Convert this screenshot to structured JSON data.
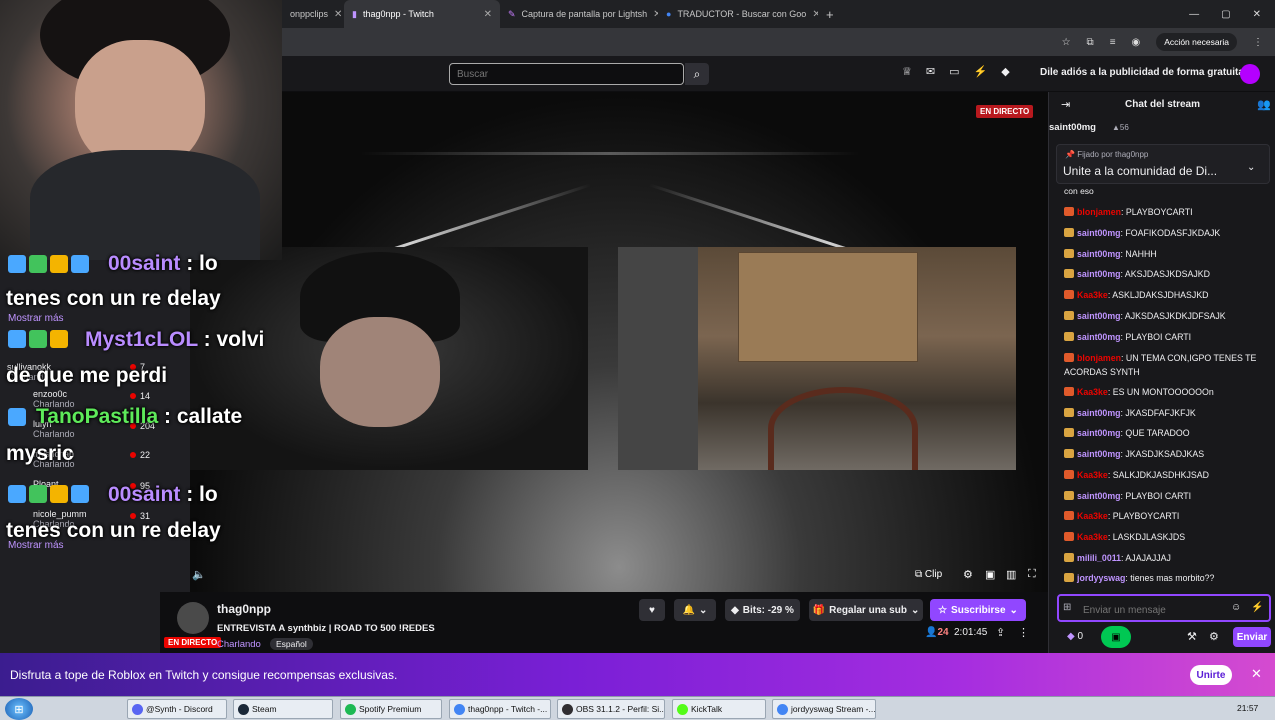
{
  "browser": {
    "tabs": [
      {
        "label": "onppclips"
      },
      {
        "label": "thag0npp - Twitch",
        "active": true
      },
      {
        "label": "Captura de pantalla por Lightsh"
      },
      {
        "label": "TRADUCTOR - Buscar con Goo"
      }
    ],
    "action_needed": "Acción necesaria"
  },
  "twitch_nav": {
    "search_placeholder": "Buscar",
    "ad_free": "Dile adiós a la publicidad de forma gratuita"
  },
  "player": {
    "live_badge": "EN DIRECTO",
    "clip": "Clip"
  },
  "left_overlay": {
    "more": "Mostrar más",
    "recs": [
      {
        "name": "sullivanokk",
        "status": "Charlando",
        "viewers": "7"
      },
      {
        "name": "enzoo0c",
        "status": "Charlando",
        "viewers": "14"
      },
      {
        "name": "lulyn",
        "status": "Charlando",
        "viewers": "204"
      },
      {
        "name": "mysrichah",
        "status": "Charlando",
        "viewers": "22"
      },
      {
        "name": "Ploant",
        "status": "",
        "viewers": "95"
      },
      {
        "name": "nicole_pumm",
        "status": "Charlando",
        "viewers": "31"
      }
    ],
    "big_messages": [
      {
        "name": "00saint",
        "text": " : lo",
        "line2": "tenes con un re delay"
      },
      {
        "name": "Myst1cLOL",
        "text": " : volvi",
        "line2": "de que me perdi"
      },
      {
        "name": "TanoPastilla",
        "text": " : callate",
        "line2": "mysric"
      },
      {
        "name": "00saint",
        "text": " : lo",
        "line2": "tenes con un re delay"
      }
    ]
  },
  "stream_info": {
    "channel": "thag0npp",
    "title": "ENTREVISTA A synthbiz | ROAD TO 500 !REDES",
    "category": "Charlando",
    "language": "Español",
    "live_badge": "EN DIRECTO",
    "bits": "Bits: -29 %",
    "gift_sub": "Regalar una sub",
    "subscribe": "Suscribirse",
    "viewers": "24",
    "uptime": "2:01:45"
  },
  "chat": {
    "header": "Chat del stream",
    "top_gifter": "saint00mg",
    "top_gifter_count": "56",
    "pinned_by": "Fijado por",
    "pinned_by_user": "thag0npp",
    "pinned_text": "Unite a la comunidad de Di...",
    "fragment": "con eso",
    "messages": [
      {
        "user": "blonjamen",
        "text": ": PLAYBOYCARTI",
        "color": "#eb0400"
      },
      {
        "user": "saint00mg",
        "text": ": FOAFIKODASFJKDAJK",
        "color": "#bf94ff"
      },
      {
        "user": "saint00mg",
        "text": ": NAHHH",
        "color": "#bf94ff"
      },
      {
        "user": "saint00mg",
        "text": ": AKSJDASJKDSAJKD",
        "color": "#bf94ff"
      },
      {
        "user": "Kaa3ke",
        "text": ": ASKLJDAKSJDHASJKD",
        "color": "#eb0400"
      },
      {
        "user": "saint00mg",
        "text": ": AJKSDASJKDKJDFSAJK",
        "color": "#bf94ff"
      },
      {
        "user": "saint00mg",
        "text": ": PLAYBOI CARTI",
        "color": "#bf94ff"
      },
      {
        "user": "blonjamen",
        "text": ": UN TEMA CON,IGPO TENES TE ACORDAS SYNTH",
        "color": "#eb0400"
      },
      {
        "user": "Kaa3ke",
        "text": ": ES UN MONTOOOOOOn",
        "color": "#eb0400"
      },
      {
        "user": "saint00mg",
        "text": ": JKASDFAFJKFJK",
        "color": "#bf94ff"
      },
      {
        "user": "saint00mg",
        "text": ": QUE TARADOO",
        "color": "#bf94ff"
      },
      {
        "user": "saint00mg",
        "text": ": JKASDJKSADJKAS",
        "color": "#bf94ff"
      },
      {
        "user": "Kaa3ke",
        "text": ": SALKJDKJASDHKJSAD",
        "color": "#eb0400"
      },
      {
        "user": "saint00mg",
        "text": ": PLAYBOI CARTI",
        "color": "#bf94ff"
      },
      {
        "user": "Kaa3ke",
        "text": ": PLAYBOYCARTI",
        "color": "#eb0400"
      },
      {
        "user": "Kaa3ke",
        "text": ": LASKDJLASKJDS",
        "color": "#eb0400"
      },
      {
        "user": "milili_0011",
        "text": ": AJAJAJJAJ",
        "color": "#bf94ff"
      },
      {
        "user": "jordyyswag",
        "text": ": tienes mas morbito??",
        "color": "#bf94ff"
      }
    ],
    "input_placeholder": "Enviar un mensaje",
    "points": "0",
    "send": "Enviar"
  },
  "banner": {
    "text": "Disfruta a tope de Roblox en Twitch y consigue recompensas exclusivas.",
    "join": "Unirte"
  },
  "taskbar": {
    "items": [
      {
        "label": "@Synth - Discord",
        "color": "#5865f2"
      },
      {
        "label": "Steam",
        "color": "#1b2838"
      },
      {
        "label": "Spotify Premium",
        "color": "#1db954"
      },
      {
        "label": "thag0npp - Twitch -...",
        "color": "#4285f4"
      },
      {
        "label": "OBS 31.1.2 - Perfil: Si...",
        "color": "#302e31"
      },
      {
        "label": "KickTalk",
        "color": "#53fc18"
      },
      {
        "label": "jordyyswag Stream -...",
        "color": "#4285f4"
      }
    ],
    "clock": "21:57"
  }
}
